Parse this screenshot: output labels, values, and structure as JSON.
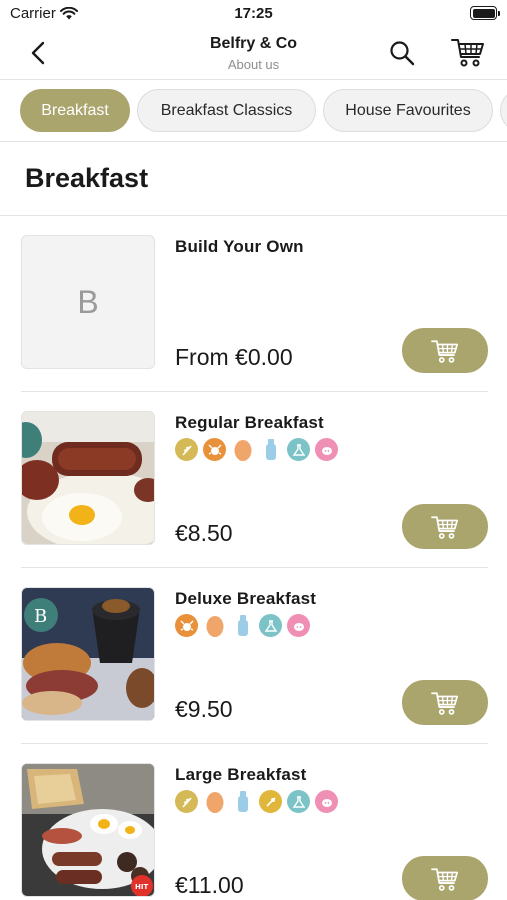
{
  "status": {
    "carrier": "Carrier",
    "time": "17:25"
  },
  "nav": {
    "title": "Belfry & Co",
    "subtitle": "About us"
  },
  "categories": [
    {
      "label": "Breakfast",
      "active": true
    },
    {
      "label": "Breakfast Classics",
      "active": false
    },
    {
      "label": "House Favourites",
      "active": false
    }
  ],
  "section": {
    "title": "Breakfast"
  },
  "items": [
    {
      "name": "Build Your Own",
      "price": "From €0.00",
      "placeholder_letter": "B",
      "allergens": []
    },
    {
      "name": "Regular Breakfast",
      "price": "€8.50",
      "allergens": [
        "gluten-icon",
        "crustacean-icon",
        "egg-icon",
        "milk-icon",
        "sulphites-icon",
        "pork-icon"
      ]
    },
    {
      "name": "Deluxe Breakfast",
      "price": "€9.50",
      "allergens": [
        "crustacean-icon",
        "egg-icon",
        "milk-icon",
        "sulphites-icon",
        "pork-icon"
      ]
    },
    {
      "name": "Large Breakfast",
      "price": "€11.00",
      "badge": "HIT",
      "allergens": [
        "gluten-icon",
        "egg-icon",
        "milk-icon",
        "mustard-icon",
        "sulphites-icon",
        "pork-icon"
      ]
    }
  ],
  "colors": {
    "accent": "#aaa46d",
    "divider": "#e3e3e3"
  }
}
